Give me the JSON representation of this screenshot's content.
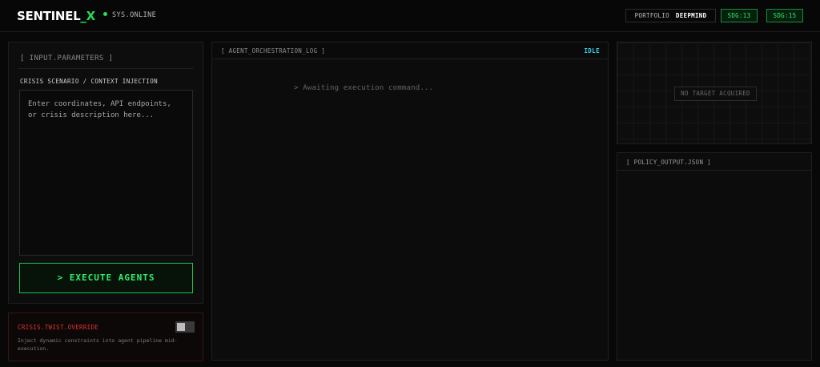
{
  "header": {
    "logo_main": "SENTINEL",
    "logo_accent": "_X",
    "status_text": "SYS.ONLINE",
    "portfolio_label": "PORTFOLIO",
    "portfolio_value": "DEEPMIND",
    "badges": [
      "SDG:13",
      "SDG:15"
    ]
  },
  "input_panel": {
    "title": "[ INPUT.PARAMETERS ]",
    "field_label": "CRISIS SCENARIO / CONTEXT INJECTION",
    "field_value": "",
    "field_placeholder": "Enter coordinates, API endpoints, or crisis description here...",
    "execute_label": "> EXECUTE AGENTS"
  },
  "crisis_override": {
    "title": "CRISIS.TWIST.OVERRIDE",
    "enabled": false,
    "description": "Inject dynamic constraints into agent pipeline mid-execution."
  },
  "log_panel": {
    "title": "[ AGENT_ORCHESTRATION_LOG ]",
    "status": "IDLE",
    "message": "> Awaiting execution command..."
  },
  "target_panel": {
    "message": "NO TARGET ACQUIRED"
  },
  "policy_panel": {
    "title": "[ POLICY_OUTPUT.JSON ]"
  },
  "colors": {
    "accent_green": "#22e055",
    "status_cyan": "#3ad1e8",
    "alert_red": "#e0322c"
  }
}
